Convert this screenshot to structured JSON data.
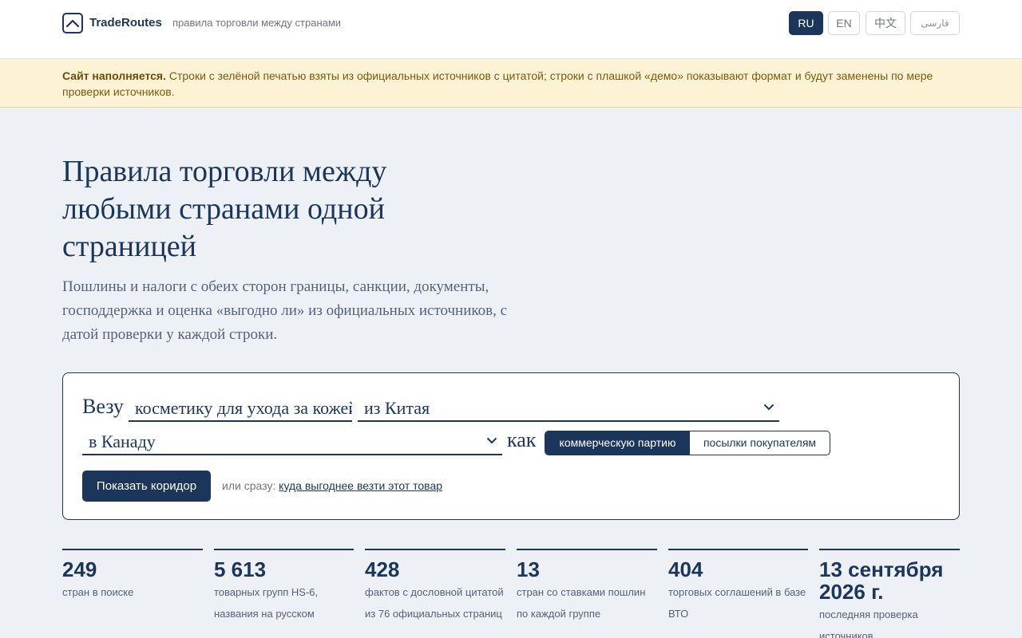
{
  "header": {
    "brand": "TradeRoutes",
    "tagline": "правила торговли между странами",
    "languages": [
      "RU",
      "EN",
      "中文",
      "فارسی"
    ],
    "active_language": "RU"
  },
  "notice": {
    "bold": "Сайт наполняется.",
    "text": "Строки с зелёной печатью взяты из официальных источников с цитатой; строки с плашкой «демо» показывают формат и будут заменены по мере проверки источников."
  },
  "hero": {
    "title": "Правила торговли между любыми странами одной страницей",
    "subtitle": "Пошлины и налоги с обеих сторон границы, санкции, документы, господдержка и оценка «выгодно ли» из официальных источников, с датой проверки у каждой строки."
  },
  "search": {
    "prefix": "Везу",
    "product_value": "косметику для ухода за кожей",
    "origin": "из Китая",
    "destination": "в Канаду",
    "as_label": "как",
    "modes": [
      "коммерческую партию",
      "посылки покупателям"
    ],
    "active_mode": "коммерческую партию",
    "submit": "Показать коридор",
    "alt_prefix": "или сразу:",
    "alt_link": "куда выгоднее везти этот товар"
  },
  "stats": [
    {
      "value": "249",
      "label": "стран в поиске"
    },
    {
      "value": "5 613",
      "label": "товарных групп HS-6, названия на русском"
    },
    {
      "value": "428",
      "label": "фактов с дословной цитатой из 76 официальных страниц"
    },
    {
      "value": "13",
      "label": "стран со ставками пошлин по каждой группе"
    },
    {
      "value": "404",
      "label": "торговых соглашений в базе ВТО"
    },
    {
      "value": "13 сентября 2026 г.",
      "label": "последняя проверка источников"
    }
  ],
  "colors": {
    "primary": "#1b365a",
    "background": "#edf1f5",
    "notice_bg": "#fdf3d4",
    "notice_text": "#7a5a0e"
  }
}
